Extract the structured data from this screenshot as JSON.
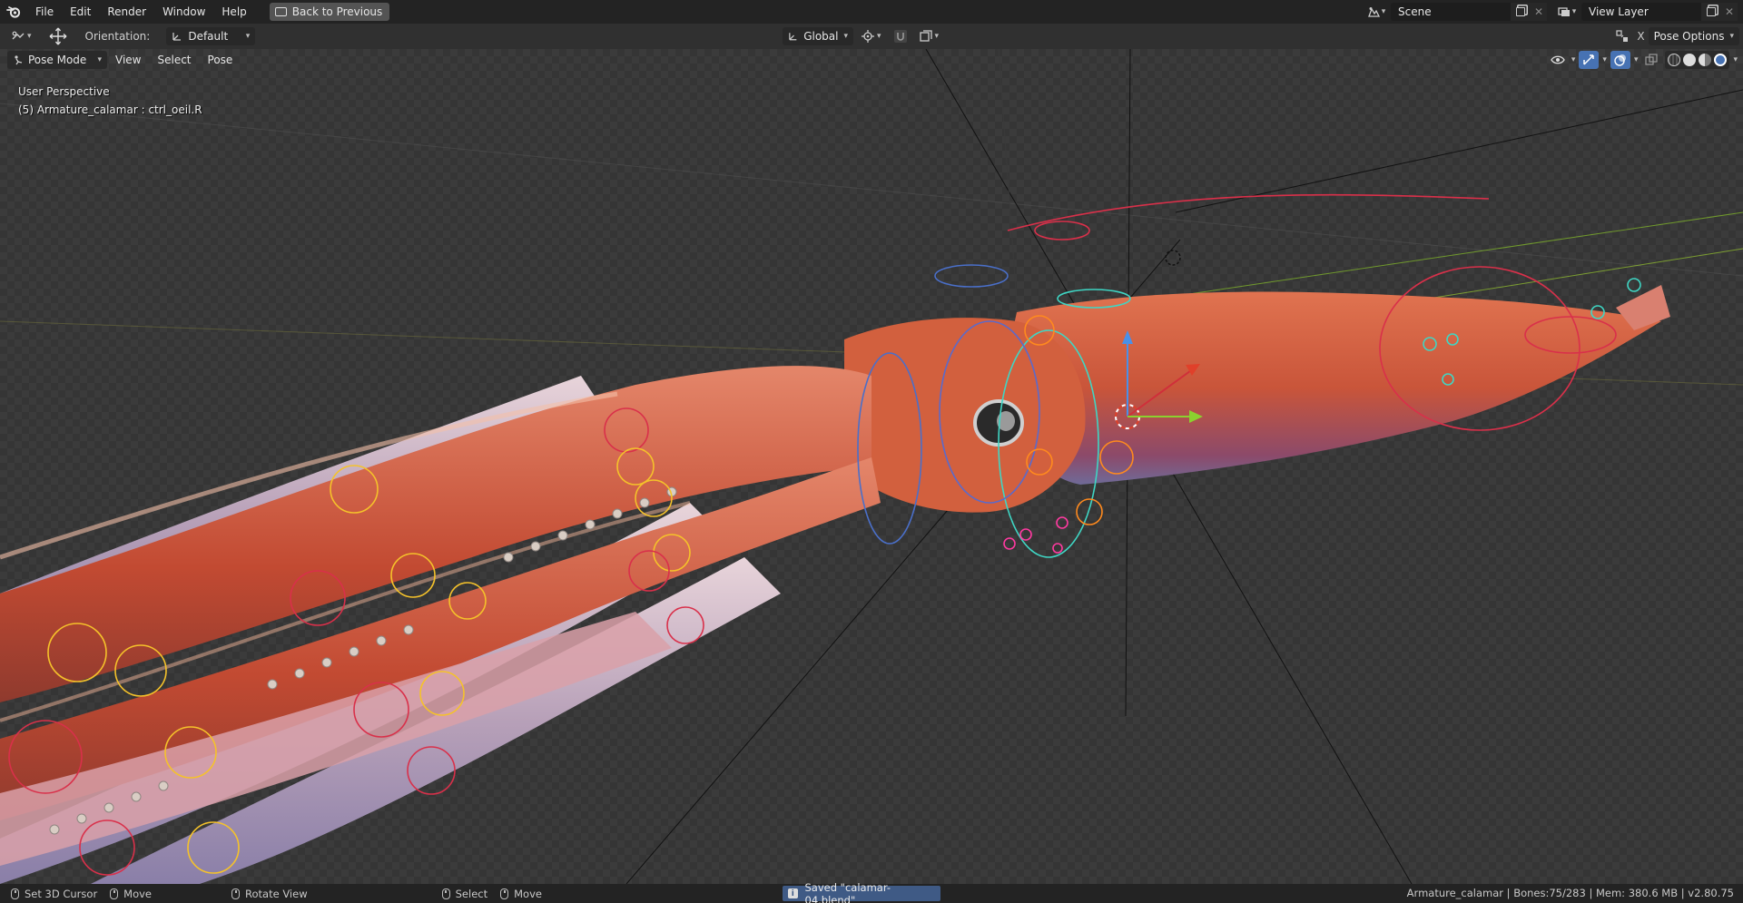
{
  "topbar": {
    "menus": [
      "File",
      "Edit",
      "Render",
      "Window",
      "Help"
    ],
    "back_button": "Back to Previous",
    "scene_name": "Scene",
    "view_layer_name": "View Layer"
  },
  "toolheader": {
    "orientation_label": "Orientation:",
    "orientation_value": "Default",
    "transform_orientation": "Global",
    "axis_label": "X",
    "pose_options": "Pose Options"
  },
  "viewport_header": {
    "mode": "Pose Mode",
    "menus": [
      "View",
      "Select",
      "Pose"
    ]
  },
  "overlay": {
    "view_name": "User Perspective",
    "active_object": "(5) Armature_calamar : ctrl_oeil.R"
  },
  "statusbar": {
    "hints": [
      "Set 3D Cursor",
      "Move",
      "Rotate View",
      "Select",
      "Move"
    ],
    "message": "Saved \"calamar-04.blend\"",
    "stats": "Armature_calamar | Bones:75/283 | Mem: 380.6 MB | v2.80.75"
  },
  "colors": {
    "accent_blue": "#4772b3",
    "message_bg": "#3f5a85",
    "squid_body": "#c9553a",
    "bone_orange": "#ff8a1e",
    "bone_yellow": "#f5c22a",
    "bone_red": "#d9304a",
    "bone_cyan": "#3fd6c4",
    "bone_blue": "#4a6fc9"
  }
}
